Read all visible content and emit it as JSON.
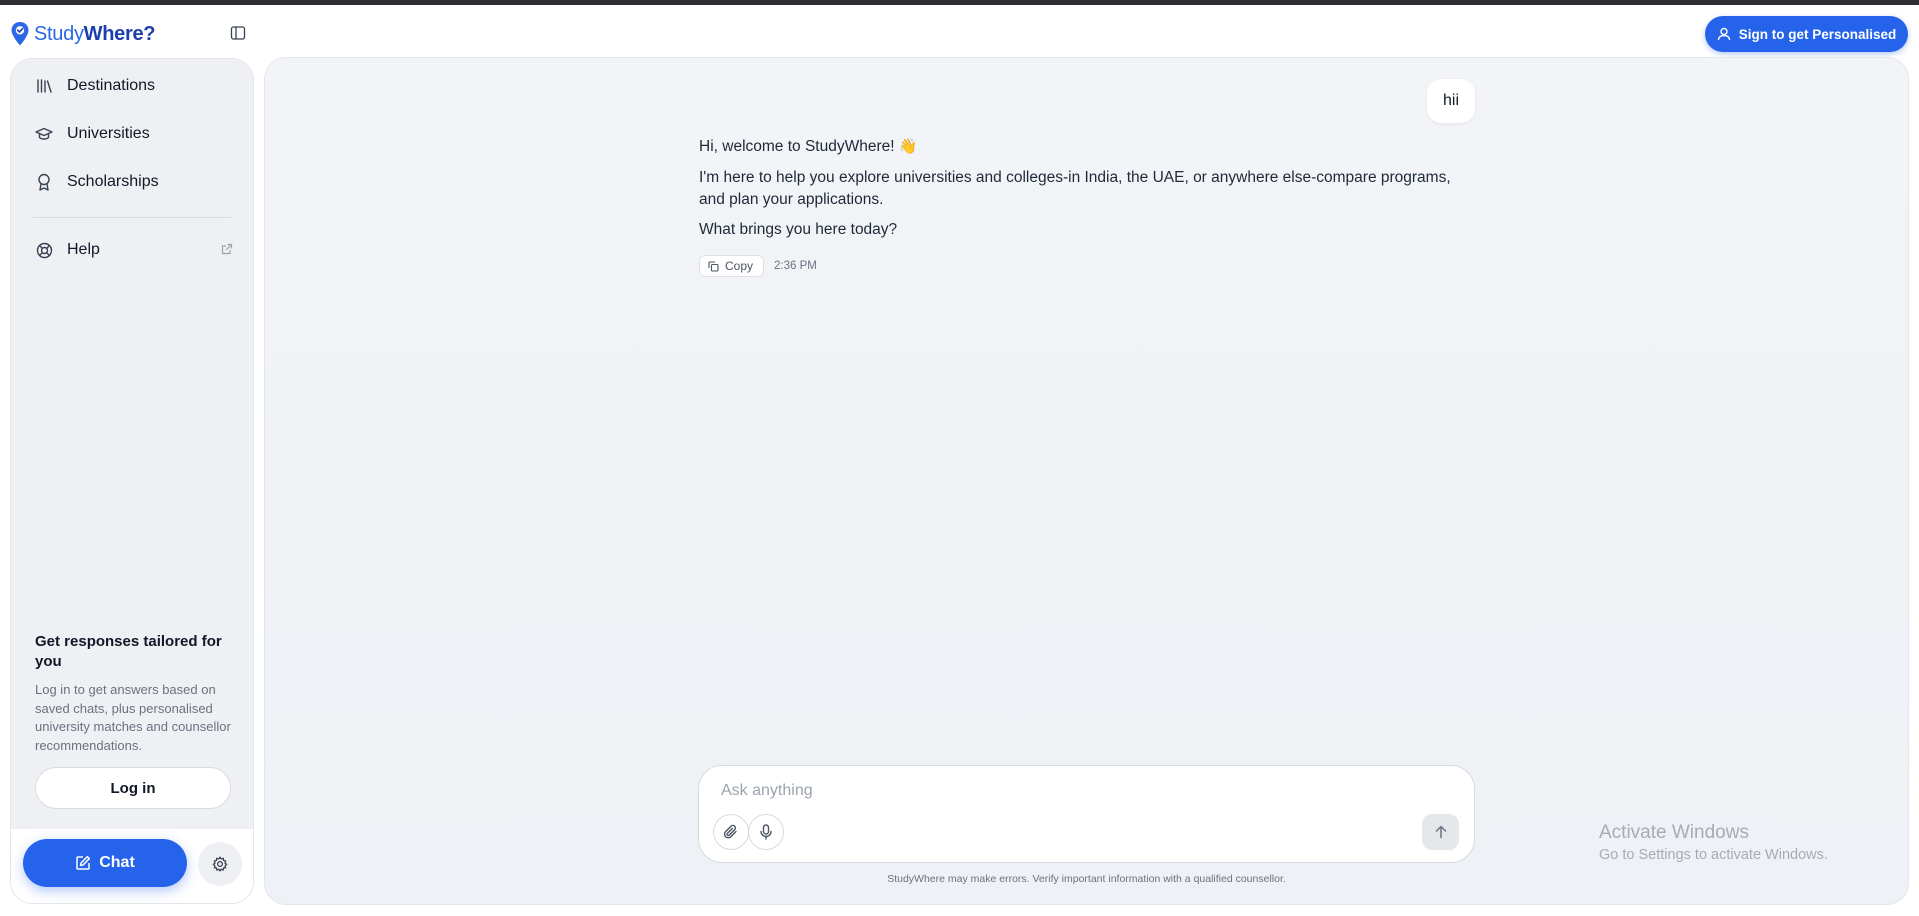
{
  "header": {
    "logo": {
      "part1": "Study",
      "part2": "Where?"
    },
    "sign_in_label": "Sign to get Personalised"
  },
  "sidebar": {
    "items": [
      {
        "label": "Destinations",
        "icon": "library-icon"
      },
      {
        "label": "Universities",
        "icon": "graduation-cap-icon"
      },
      {
        "label": "Scholarships",
        "icon": "award-icon"
      }
    ],
    "help_label": "Help",
    "promo_title": "Get responses tailored for you",
    "promo_desc": "Log in to get answers based on saved chats, plus personalised university matches and counsellor recommendations.",
    "login_label": "Log in",
    "chat_label": "Chat"
  },
  "conversation": {
    "user_message": "hii",
    "bot_lines": [
      "Hi, welcome to StudyWhere!",
      "I'm here to help you explore universities and colleges-in India, the UAE, or anywhere else-compare programs, and plan your applications.",
      "What brings you here today?"
    ],
    "wave_emoji": "👋",
    "copy_label": "Copy",
    "time": "2:36 PM"
  },
  "composer": {
    "placeholder": "Ask anything",
    "disclaimer": "StudyWhere may make errors. Verify important information with a qualified counsellor."
  },
  "watermark": {
    "line1": "Activate Windows",
    "line2": "Go to Settings to activate Windows."
  },
  "colors": {
    "accent": "#2563eb",
    "logo_blue": "#2b67e6",
    "logo_dark": "#1d3fae",
    "sidebar_bg": "#eef0f4"
  }
}
